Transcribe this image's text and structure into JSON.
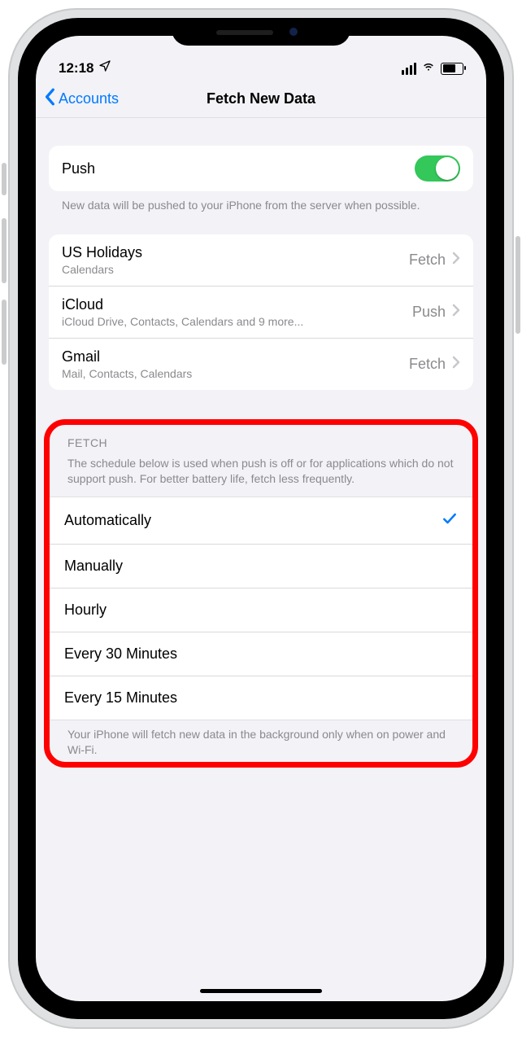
{
  "status": {
    "time": "12:18"
  },
  "nav": {
    "back_label": "Accounts",
    "title": "Fetch New Data"
  },
  "push": {
    "label": "Push",
    "footer": "New data will be pushed to your iPhone from the server when possible."
  },
  "accounts": [
    {
      "name": "US Holidays",
      "sub": "Calendars",
      "mode": "Fetch"
    },
    {
      "name": "iCloud",
      "sub": "iCloud Drive, Contacts, Calendars and 9 more...",
      "mode": "Push"
    },
    {
      "name": "Gmail",
      "sub": "Mail, Contacts, Calendars",
      "mode": "Fetch"
    }
  ],
  "fetch": {
    "section_label": "FETCH",
    "header": "The schedule below is used when push is off or for applications which do not support push. For better battery life, fetch less frequently.",
    "options": [
      {
        "label": "Automatically",
        "selected": true
      },
      {
        "label": "Manually",
        "selected": false
      },
      {
        "label": "Hourly",
        "selected": false
      },
      {
        "label": "Every 30 Minutes",
        "selected": false
      },
      {
        "label": "Every 15 Minutes",
        "selected": false
      }
    ],
    "footer": "Your iPhone will fetch new data in the background only when on power and Wi-Fi."
  }
}
